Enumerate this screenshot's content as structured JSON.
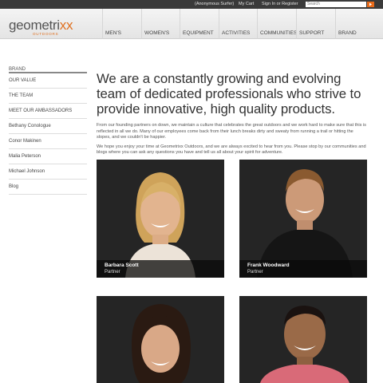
{
  "topbar": {
    "anonymous": "(Anonymous Surfer)",
    "cart": "My Cart",
    "sign_in": "Sign In or Register",
    "search_placeholder": "Search"
  },
  "logo": {
    "word_a": "geometri",
    "word_b": "xx",
    "sub": "OUTDOORS"
  },
  "nav": [
    "MEN'S",
    "WOMEN'S",
    "EQUIPMENT",
    "ACTIVITIES",
    "COMMUNITIES",
    "SUPPORT",
    "BRAND"
  ],
  "sidebar": {
    "title": "BRAND",
    "links": [
      "OUR VALUE",
      "THE TEAM",
      "MEET OUR AMBASSADORS",
      "Bethany Conologue",
      "Conor Makinen",
      "Malia Peterson",
      "Michael Johnson",
      "Blog"
    ]
  },
  "main": {
    "headline": "We are a constantly growing and evolving team of dedicated professionals who strive to provide innovative, high quality products.",
    "para1": "From our founding partners on down, we maintain a culture that celebrates the great outdoors and we work hard to make sure that this is reflected in all we do. Many of our employees come back from their lunch breaks dirty and sweaty from running a trail or hitting the slopes, and we couldn't be happier.",
    "para2": "We hope you enjoy your time at Geometrixx Outdoors, and we are always excited to hear from you. Please stop by our communities and blogs where you can ask any questions you have and tell us all about your spirit for adventure."
  },
  "team": [
    {
      "name": "Barbara Scott",
      "role": "Partner"
    },
    {
      "name": "Frank Woodward",
      "role": "Partner"
    },
    {
      "name": "",
      "role": ""
    },
    {
      "name": "",
      "role": ""
    }
  ],
  "colors": {
    "accent": "#e07020",
    "topbar": "#3a3a3a"
  }
}
